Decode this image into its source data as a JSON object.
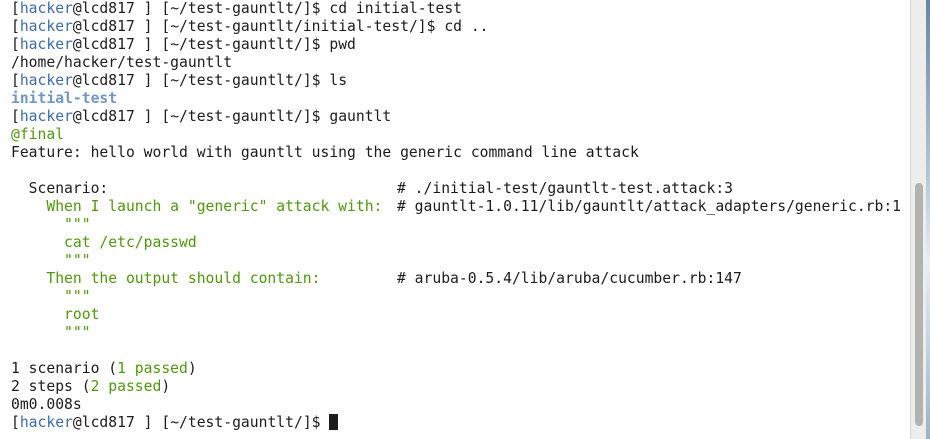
{
  "prompt": {
    "user": "hacker",
    "at": "@lcd817",
    "open": "[",
    "mid": " ] [",
    "close": "]$ "
  },
  "lines": [
    {
      "dir": "~/test-gauntlt/",
      "cmd": "cd initial-test"
    },
    {
      "dir": "~/test-gauntlt/initial-test/",
      "cmd": "cd .."
    },
    {
      "dir": "~/test-gauntlt/",
      "cmd": "pwd"
    },
    {
      "output": "/home/hacker/test-gauntlt"
    },
    {
      "dir": "~/test-gauntlt/",
      "cmd": "ls"
    },
    {
      "dir_listing": "initial-test"
    },
    {
      "dir": "~/test-gauntlt/",
      "cmd": "gauntlt"
    }
  ],
  "cucumber": {
    "tag": "@final",
    "feature": "Feature: hello world with gauntlt using the generic command line attack",
    "scenario_label": "  Scenario:",
    "scenario_comment": "# ./initial-test/gauntlt-test.attack:3",
    "step1": "    When I launch a \"generic\" attack with:",
    "step1_comment": "# gauntlt-1.0.11/lib/gauntlt/attack_adapters/generic.rb:1",
    "docstring_quote": "      \"\"\"",
    "step1_body": "      cat /etc/passwd",
    "step2": "    Then the output should contain:",
    "step2_comment": "# aruba-0.5.4/lib/aruba/cucumber.rb:147",
    "step2_body": "      root"
  },
  "summary": {
    "scenarios_prefix": "1 scenario (",
    "scenarios_passed": "1 passed",
    "steps_prefix": "2 steps (",
    "steps_passed": "2 passed",
    "suffix": ")",
    "time": "0m0.008s"
  },
  "final_prompt": {
    "dir": "~/test-gauntlt/"
  }
}
